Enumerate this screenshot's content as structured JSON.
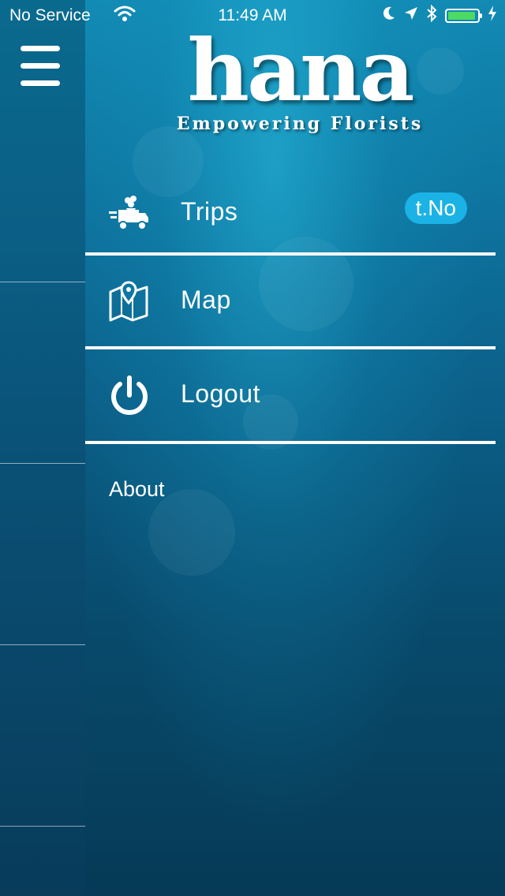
{
  "status_bar": {
    "carrier": "No Service",
    "time": "11:49 AM",
    "battery_level": 0.85,
    "icons": [
      "wifi-icon",
      "moon-icon",
      "location-arrow-icon",
      "bluetooth-icon",
      "battery-icon",
      "charging-bolt-icon"
    ]
  },
  "header": {
    "menu_icon": "hamburger-menu-icon",
    "logo_text": "hana",
    "logo_tagline": "Empowering Florists"
  },
  "menu": {
    "items": [
      {
        "label": "Trips",
        "icon": "delivery-truck-icon",
        "badge": "t.No"
      },
      {
        "label": "Map",
        "icon": "map-pin-icon"
      },
      {
        "label": "Logout",
        "icon": "power-icon"
      }
    ],
    "about_label": "About"
  },
  "colors": {
    "drawer_top": "#128ab4",
    "drawer_bottom": "#063a56",
    "badge": "#1bb2e6",
    "battery": "#4cd964"
  }
}
